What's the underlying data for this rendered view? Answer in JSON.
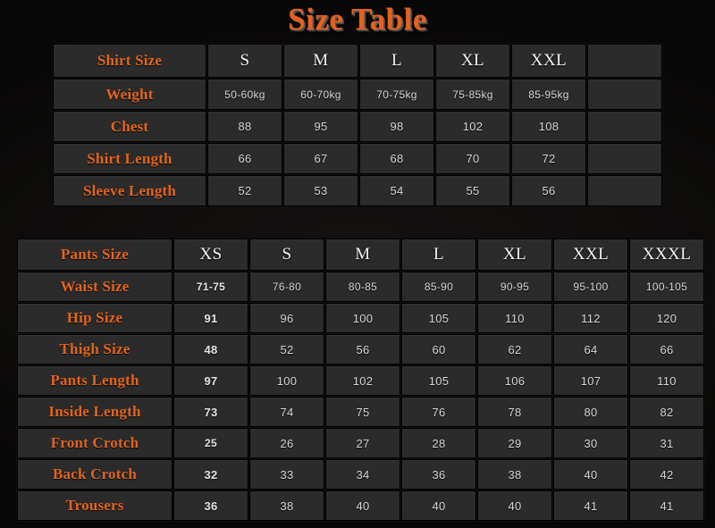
{
  "title": "Size Table",
  "colors": {
    "accent": "#e2641f",
    "title": "#e8601c",
    "value_text": "#d6d6d6",
    "header_text": "#f2f2f2",
    "cell_bg": "#2b2b2b",
    "page_bg": "#0d0c0b"
  },
  "shirt_table": {
    "label_column_header": "Shirt Size",
    "size_headers": [
      "S",
      "M",
      "L",
      "XL",
      "XXL",
      ""
    ],
    "rows": [
      {
        "label": "Weight",
        "values": [
          "50-60kg",
          "60-70kg",
          "70-75kg",
          "75-85kg",
          "85-95kg",
          ""
        ]
      },
      {
        "label": "Chest",
        "values": [
          "88",
          "95",
          "98",
          "102",
          "108",
          ""
        ]
      },
      {
        "label": "Shirt Length",
        "values": [
          "66",
          "67",
          "68",
          "70",
          "72",
          ""
        ]
      },
      {
        "label": "Sleeve Length",
        "values": [
          "52",
          "53",
          "54",
          "55",
          "56",
          ""
        ]
      }
    ]
  },
  "pants_table": {
    "label_column_header": "Pants Size",
    "size_headers": [
      "XS",
      "S",
      "M",
      "L",
      "XL",
      "XXL",
      "XXXL"
    ],
    "rows": [
      {
        "label": "Waist Size",
        "values": [
          "71-75",
          "76-80",
          "80-85",
          "85-90",
          "90-95",
          "95-100",
          "100-105"
        ]
      },
      {
        "label": "Hip Size",
        "values": [
          "91",
          "96",
          "100",
          "105",
          "110",
          "112",
          "120"
        ]
      },
      {
        "label": "Thigh Size",
        "values": [
          "48",
          "52",
          "56",
          "60",
          "62",
          "64",
          "66"
        ]
      },
      {
        "label": "Pants Length",
        "values": [
          "97",
          "100",
          "102",
          "105",
          "106",
          "107",
          "110"
        ]
      },
      {
        "label": "Inside Length",
        "values": [
          "73",
          "74",
          "75",
          "76",
          "78",
          "80",
          "82"
        ]
      },
      {
        "label": "Front Crotch",
        "values": [
          "25",
          "26",
          "27",
          "28",
          "29",
          "30",
          "31"
        ]
      },
      {
        "label": "Back Crotch",
        "values": [
          "32",
          "33",
          "34",
          "36",
          "38",
          "40",
          "42"
        ]
      },
      {
        "label": "Trousers",
        "values": [
          "36",
          "38",
          "40",
          "40",
          "40",
          "41",
          "41"
        ]
      }
    ]
  }
}
